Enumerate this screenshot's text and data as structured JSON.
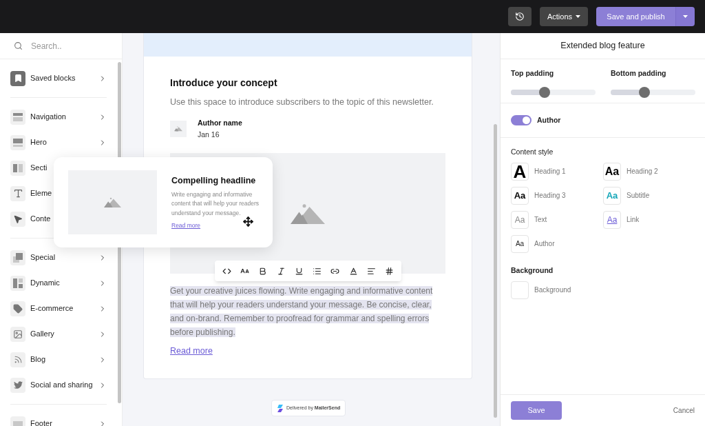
{
  "topbar": {
    "actions_label": "Actions",
    "publish_label": "Save and publish"
  },
  "sidebar": {
    "search": {
      "placeholder": "Search.."
    },
    "groups": [
      [
        {
          "label": "Saved blocks",
          "chevron": true
        }
      ],
      [
        {
          "label": "Navigation",
          "chevron": true
        },
        {
          "label": "Hero",
          "chevron": true
        },
        {
          "label": "Secti",
          "chevron": false
        },
        {
          "label": "Eleme",
          "chevron": false
        },
        {
          "label": "Conte",
          "chevron": false
        }
      ],
      [
        {
          "label": "Special",
          "chevron": true
        },
        {
          "label": "Dynamic",
          "chevron": true
        },
        {
          "label": "E-commerce",
          "chevron": true
        },
        {
          "label": "Gallery",
          "chevron": true
        },
        {
          "label": "Blog",
          "chevron": true
        },
        {
          "label": "Social and sharing",
          "chevron": true
        }
      ],
      [
        {
          "label": "Footer",
          "chevron": true
        }
      ]
    ]
  },
  "email": {
    "heading": "Introduce your concept",
    "intro": "Use this space to introduce subscribers to the topic of this newsletter.",
    "author": {
      "name": "Author name",
      "date": "Jan 16"
    },
    "body": "Get your creative juices flowing. Write engaging and informative content that will help your readers understand your message. Be concise, clear, and on-brand. Remember to proofread for grammar and spelling errors before publishing.",
    "body_selected": true,
    "link": "Read more",
    "badge": "Delivered by **MailerSend**"
  },
  "drag_card": {
    "title": "Compelling headline",
    "text": "Write engaging and informative content that will help your readers understand your message.",
    "link": "Read more"
  },
  "panel": {
    "title": "Extended blog feature",
    "sliders": [
      {
        "label": "Top padding",
        "level": 0.4
      },
      {
        "label": "Bottom padding",
        "level": 0.4
      }
    ],
    "toggle": {
      "label": "Author",
      "on": true
    },
    "content_style": {
      "label": "Content style",
      "styles": [
        {
          "kind": "h1",
          "sample": "A",
          "label": "Heading 1"
        },
        {
          "kind": "h2",
          "sample": "Aa",
          "label": "Heading 2"
        },
        {
          "kind": "h3",
          "sample": "Aa",
          "label": "Heading 3"
        },
        {
          "kind": "subtitle",
          "sample": "Aa",
          "label": "Subtitle"
        },
        {
          "kind": "text",
          "sample": "Aa",
          "label": "Text"
        },
        {
          "kind": "link",
          "sample": "Aa",
          "label": "Link"
        },
        {
          "kind": "author",
          "sample": "Aa",
          "label": "Author"
        }
      ]
    },
    "background": {
      "label": "Background",
      "swatch_label": "Background",
      "color": "#ffffff"
    },
    "save": "Save",
    "cancel": "Cancel"
  }
}
